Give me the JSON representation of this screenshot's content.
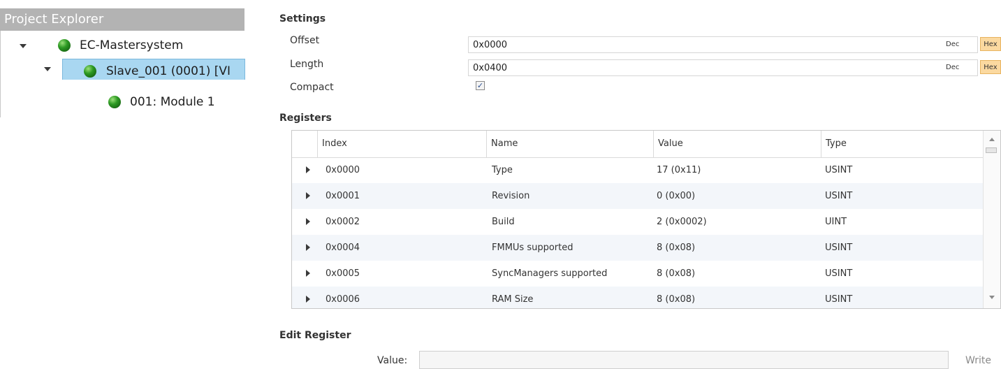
{
  "explorer": {
    "title": "Project Explorer",
    "nodes": [
      {
        "label": "EC-Mastersystem",
        "expanded": true
      },
      {
        "label": "Slave_001 (0001) [VI",
        "expanded": true,
        "selected": true
      },
      {
        "label": "001: Module 1",
        "expanded": false
      }
    ]
  },
  "settings": {
    "title": "Settings",
    "offset": {
      "label": "Offset",
      "value": "0x0000",
      "dec": "Dec",
      "hex": "Hex"
    },
    "length": {
      "label": "Length",
      "value": "0x0400",
      "dec": "Dec",
      "hex": "Hex"
    },
    "compact": {
      "label": "Compact",
      "checked": true,
      "check_glyph": "✓"
    }
  },
  "registers": {
    "title": "Registers",
    "columns": [
      "Index",
      "Name",
      "Value",
      "Type"
    ],
    "rows": [
      {
        "index": "0x0000",
        "name": "Type",
        "value": "17 (0x11)",
        "type": "USINT"
      },
      {
        "index": "0x0001",
        "name": "Revision",
        "value": "0 (0x00)",
        "type": "USINT"
      },
      {
        "index": "0x0002",
        "name": "Build",
        "value": "2 (0x0002)",
        "type": "UINT"
      },
      {
        "index": "0x0004",
        "name": "FMMUs supported",
        "value": "8 (0x08)",
        "type": "USINT"
      },
      {
        "index": "0x0005",
        "name": "SyncManagers supported",
        "value": "8 (0x08)",
        "type": "USINT"
      },
      {
        "index": "0x0006",
        "name": "RAM Size",
        "value": "8 (0x08)",
        "type": "USINT"
      }
    ]
  },
  "edit_register": {
    "title": "Edit Register",
    "value_label": "Value:",
    "value": "",
    "write_label": "Write"
  }
}
